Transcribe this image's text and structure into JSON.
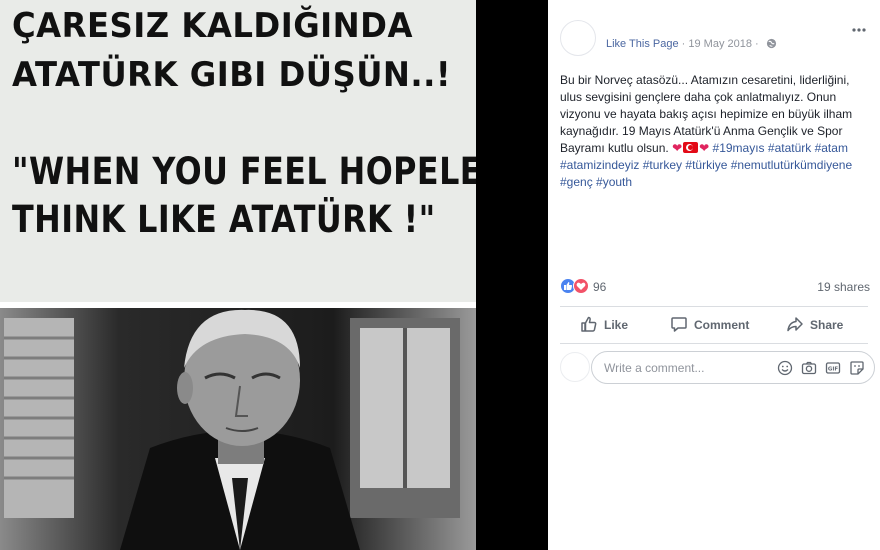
{
  "image": {
    "meme_line_1": "ÇARESIZ KALDIĞINDA",
    "meme_line_2": "ATATÜRK GIBI DÜŞÜN..!",
    "meme_line_3": "\"WHEN YOU FEEL HOPELESS",
    "meme_line_4": "THINK LIKE ATATÜRK !\""
  },
  "post": {
    "like_page_label": "Like This Page",
    "date": "19 May 2018",
    "separator": "·",
    "more_icon": "more-options-icon",
    "body": "Bu bir Norveç atasözü... Atamızın cesaretini, liderliğini, ulus sevgisini gençlere daha çok anlatmalıyız. Onun vizyonu ve hayata bakış açısı hepimize en büyük ilham kaynağıdır. 19 Mayıs Atatürk'ü Anma Gençlik ve Spor Bayramı kutlu olsun.",
    "hashtags": "#19mayıs #atatürk #atam #atamizindeyiz #turkey #türkiye #nemutlutürkümdiyene #genç #youth"
  },
  "reactions": {
    "count": "96",
    "shares": "19 shares"
  },
  "actions": {
    "like_label": "Like",
    "comment_label": "Comment",
    "share_label": "Share"
  },
  "comment": {
    "placeholder": "Write a comment..."
  },
  "colors": {
    "link_blue": "#365899",
    "facebook_blue": "#4b67a1",
    "love_red": "#f25268",
    "like_blue": "#4a83f0"
  }
}
